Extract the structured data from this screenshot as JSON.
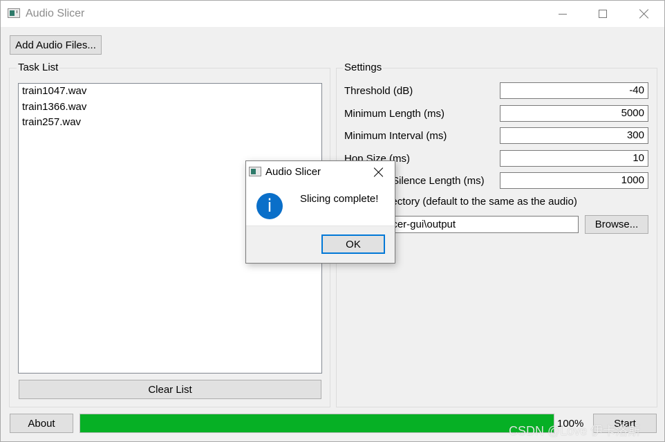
{
  "window": {
    "title": "Audio Slicer",
    "controls": [
      "minimize",
      "maximize",
      "close"
    ]
  },
  "toolbar": {
    "add_files_label": "Add Audio Files..."
  },
  "task_list": {
    "title": "Task List",
    "items": [
      "train1047.wav",
      "train1366.wav",
      "train257.wav"
    ],
    "clear_label": "Clear List"
  },
  "settings": {
    "title": "Settings",
    "fields": [
      {
        "label": "Threshold (dB)",
        "value": "-40"
      },
      {
        "label": "Minimum Length (ms)",
        "value": "5000"
      },
      {
        "label": "Minimum Interval (ms)",
        "value": "300"
      },
      {
        "label": "Hop Size (ms)",
        "value": "10"
      },
      {
        "label": "Maximum Silence Length (ms)",
        "value": "1000"
      }
    ],
    "output_label": "Output Directory (default to the same as the audio)",
    "output_value": "【包】\\slicer-gui\\output",
    "browse_label": "Browse..."
  },
  "footer": {
    "about_label": "About",
    "progress_percent": 100,
    "progress_text": "100%",
    "start_label": "Start",
    "progress_color": "#06b025"
  },
  "dialog": {
    "title": "Audio Slicer",
    "icon": "info-icon",
    "message": "Slicing complete!",
    "ok_label": "OK",
    "info_icon_glyph": "i"
  },
  "watermark": "CSDN @Love 伊卡洛斯"
}
